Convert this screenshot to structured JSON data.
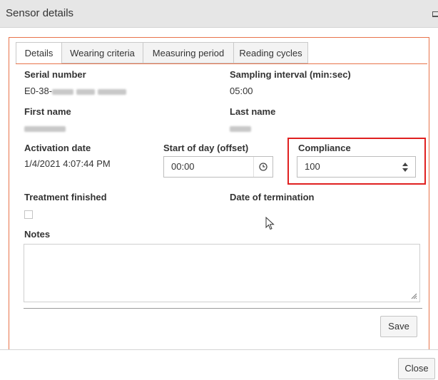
{
  "window": {
    "title": "Sensor details"
  },
  "tabs": [
    {
      "label": "Details",
      "active": true
    },
    {
      "label": "Wearing criteria",
      "active": false
    },
    {
      "label": "Measuring period",
      "active": false
    },
    {
      "label": "Reading cycles",
      "active": false
    }
  ],
  "fields": {
    "serial_number": {
      "label": "Serial number",
      "value": "E0-38-"
    },
    "sampling_interval": {
      "label": "Sampling interval (min:sec)",
      "value": "05:00"
    },
    "first_name": {
      "label": "First name"
    },
    "last_name": {
      "label": "Last name"
    },
    "activation_date": {
      "label": "Activation date",
      "value": "1/4/2021 4:07:44 PM"
    },
    "start_of_day": {
      "label": "Start of day (offset)",
      "value": "00:00"
    },
    "compliance": {
      "label": "Compliance",
      "value": "100"
    },
    "treatment_finished": {
      "label": "Treatment finished",
      "checked": false
    },
    "date_of_termination": {
      "label": "Date of termination"
    },
    "notes": {
      "label": "Notes",
      "value": ""
    }
  },
  "buttons": {
    "save": "Save",
    "close": "Close"
  },
  "colors": {
    "accent": "#e8734a",
    "highlight": "#e02020"
  }
}
